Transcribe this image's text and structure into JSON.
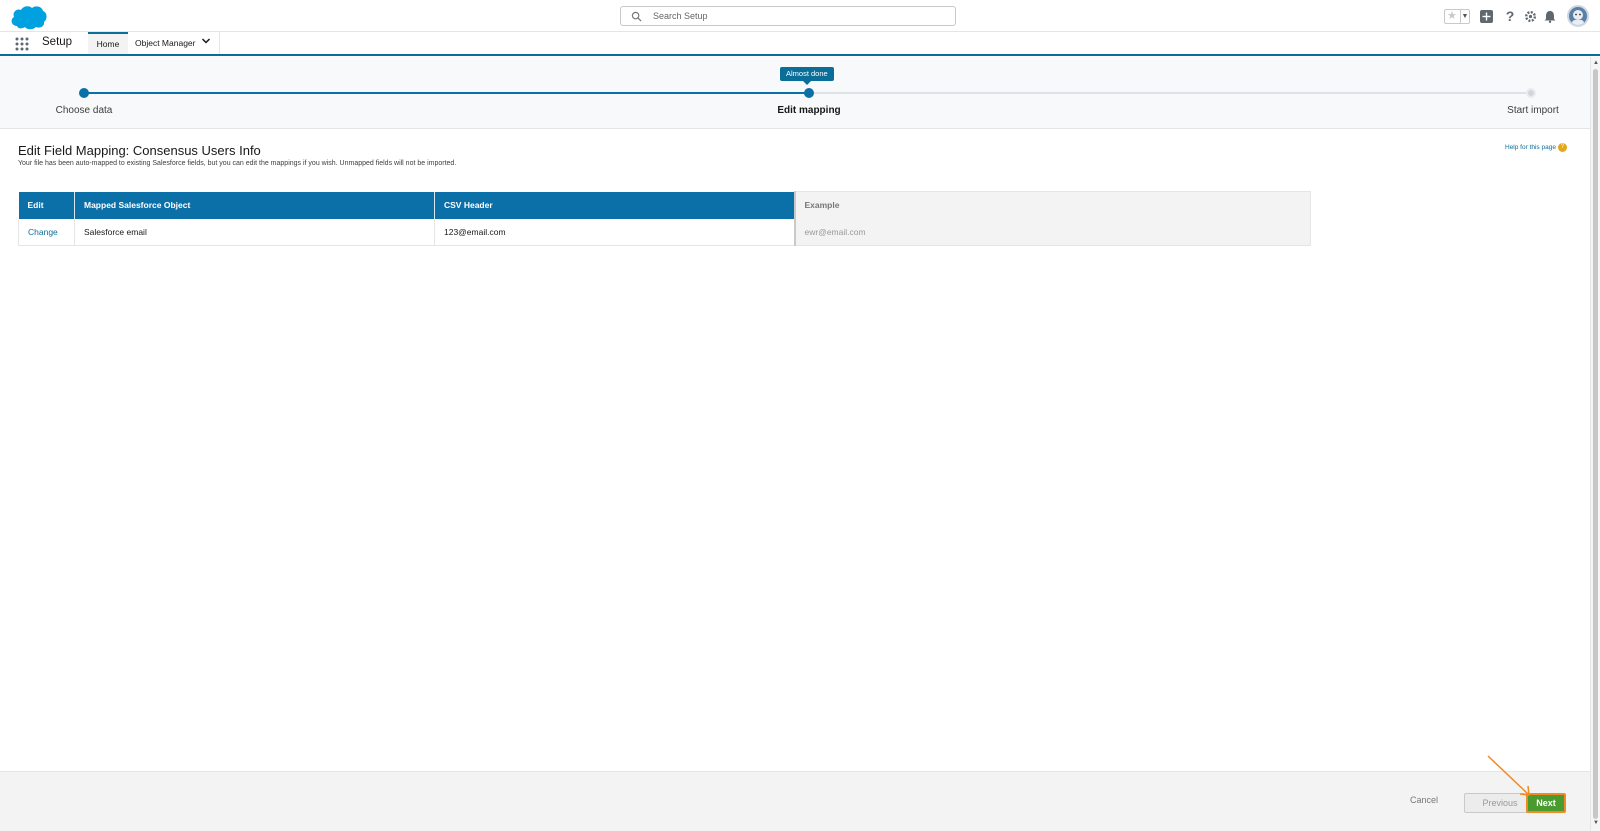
{
  "header": {
    "search_placeholder": "Search Setup",
    "icons": [
      "salesforce-cloud-logo",
      "search-icon",
      "star-icon",
      "add-icon",
      "help-icon",
      "gear-icon",
      "bell-icon",
      "avatar"
    ]
  },
  "nav": {
    "app_name": "Setup",
    "tabs": [
      {
        "label": "Home",
        "active": true
      },
      {
        "label": "Object Manager",
        "has_dropdown": true
      }
    ]
  },
  "progress": {
    "badge": "Almost done",
    "steps": [
      {
        "label": "Choose data",
        "state": "done"
      },
      {
        "label": "Edit mapping",
        "state": "current"
      },
      {
        "label": "Start import",
        "state": "todo"
      }
    ]
  },
  "content": {
    "title": "Edit Field Mapping: Consensus Users Info",
    "description": "Your file has been auto-mapped to existing Salesforce fields, but you can edit the mappings if you wish. Unmapped fields will not be imported.",
    "help_link": "Help for this page",
    "table": {
      "headers": [
        "Edit",
        "Mapped Salesforce Object",
        "CSV Header",
        "Example"
      ],
      "rows": [
        [
          "Change",
          "Salesforce email",
          "123@email.com",
          "ewr@email.com"
        ]
      ]
    }
  },
  "footer": {
    "cancel": "Cancel",
    "previous": "Previous",
    "next": "Next"
  },
  "colors": {
    "brand_blue": "#0b70a8",
    "next_green": "#4a9b2f",
    "highlight_orange": "#f08a24"
  }
}
